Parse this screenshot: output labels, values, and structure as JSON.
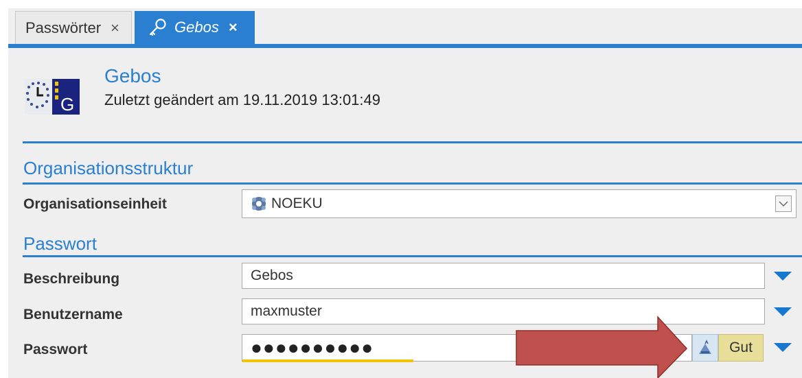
{
  "tabs": [
    {
      "label": "Passwörter",
      "close": "×"
    },
    {
      "label": "Gebos",
      "close": "×"
    }
  ],
  "header": {
    "title": "Gebos",
    "subtitle": "Zuletzt geändert am 19.11.2019 13:01:49",
    "icon": "gebos-logo-icon"
  },
  "sections": {
    "org": "Organisationsstruktur",
    "password": "Passwort"
  },
  "fields": {
    "org_unit": {
      "label": "Organisationseinheit",
      "value": "NOEKU",
      "icon": "organisation-unit-icon"
    },
    "description": {
      "label": "Beschreibung",
      "value": "Gebos"
    },
    "username": {
      "label": "Benutzername",
      "value": "maxmuster"
    },
    "password": {
      "label": "Passwort",
      "value": "●●●●●●●●●●",
      "strength": "Gut",
      "strength_level": 0.38
    }
  },
  "colors": {
    "accent": "#2a7fd0",
    "strength": "#f0c400",
    "annotation_arrow": "#c0504d"
  }
}
